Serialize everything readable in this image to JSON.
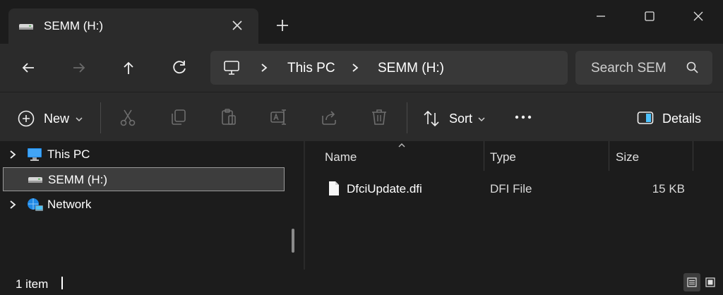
{
  "tab": {
    "title": "SEMM (H:)"
  },
  "address": {
    "crumbs": [
      "This PC",
      "SEMM (H:)"
    ]
  },
  "search": {
    "placeholder": "Search SEM"
  },
  "toolbar": {
    "new_label": "New",
    "sort_label": "Sort",
    "details_label": "Details"
  },
  "nav_tree": [
    {
      "label": "This PC",
      "icon": "computer-icon",
      "expandable": true,
      "selected": false
    },
    {
      "label": "SEMM (H:)",
      "icon": "drive-icon",
      "expandable": false,
      "selected": true
    },
    {
      "label": "Network",
      "icon": "network-icon",
      "expandable": true,
      "selected": false
    }
  ],
  "columns": [
    "Name",
    "Type",
    "Size"
  ],
  "files": [
    {
      "name": "DfciUpdate.dfi",
      "type": "DFI File",
      "size": "15 KB",
      "icon": "file-icon"
    }
  ],
  "status": {
    "text": "1 item"
  },
  "colors": {
    "background": "#1c1c1c",
    "chrome": "#2b2b2b",
    "accent": "#4cc2ff"
  }
}
